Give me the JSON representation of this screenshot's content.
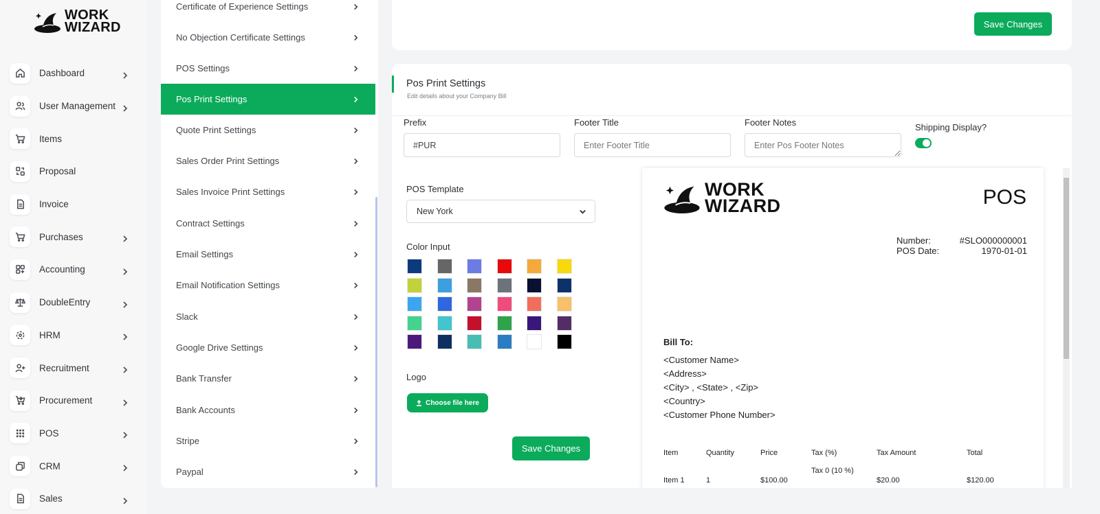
{
  "brand": {
    "line1": "WORK",
    "line2": "WIZARD"
  },
  "sidebar": {
    "items": [
      {
        "label": "Dashboard",
        "icon": "home-icon",
        "chevron": true
      },
      {
        "label": "User Management",
        "icon": "users-icon",
        "chevron": true
      },
      {
        "label": "Items",
        "icon": "cart-icon",
        "chevron": false
      },
      {
        "label": "Proposal",
        "icon": "proposal-icon",
        "chevron": false
      },
      {
        "label": "Invoice",
        "icon": "file-icon",
        "chevron": false
      },
      {
        "label": "Purchases",
        "icon": "cart-icon",
        "chevron": true
      },
      {
        "label": "Accounting",
        "icon": "grid-plus-icon",
        "chevron": true
      },
      {
        "label": "DoubleEntry",
        "icon": "scale-icon",
        "chevron": true
      },
      {
        "label": "HRM",
        "icon": "hrm-icon",
        "chevron": true
      },
      {
        "label": "Recruitment",
        "icon": "user-plus-icon",
        "chevron": true
      },
      {
        "label": "Procurement",
        "icon": "procurement-icon",
        "chevron": true
      },
      {
        "label": "POS",
        "icon": "dots-grid-icon",
        "chevron": true
      },
      {
        "label": "CRM",
        "icon": "crm-icon",
        "chevron": true
      },
      {
        "label": "Sales",
        "icon": "file-icon",
        "chevron": true
      }
    ]
  },
  "submenu": {
    "items": [
      {
        "label": "Certificate of Experience Settings",
        "active": false
      },
      {
        "label": "No Objection Certificate Settings",
        "active": false
      },
      {
        "label": "POS Settings",
        "active": false
      },
      {
        "label": "Pos Print Settings",
        "active": true
      },
      {
        "label": "Quote Print Settings",
        "active": false
      },
      {
        "label": "Sales Order Print Settings",
        "active": false
      },
      {
        "label": "Sales Invoice Print Settings",
        "active": false
      },
      {
        "label": "Contract Settings",
        "active": false
      },
      {
        "label": "Email Settings",
        "active": false
      },
      {
        "label": "Email Notification Settings",
        "active": false
      },
      {
        "label": "Slack",
        "active": false
      },
      {
        "label": "Google Drive Settings",
        "active": false
      },
      {
        "label": "Bank Transfer",
        "active": false
      },
      {
        "label": "Bank Accounts",
        "active": false
      },
      {
        "label": "Stripe",
        "active": false
      },
      {
        "label": "Paypal",
        "active": false
      }
    ]
  },
  "top_card": {
    "save_label": "Save Changes"
  },
  "form": {
    "title": "Pos Print Settings",
    "subtitle": "Edit details about your Company Bill",
    "prefix": {
      "label": "Prefix",
      "value": "#PUR",
      "placeholder": ""
    },
    "footer_title": {
      "label": "Footer Title",
      "value": "",
      "placeholder": "Enter Footer Title"
    },
    "footer_notes": {
      "label": "Footer Notes",
      "value": "",
      "placeholder": "Enter Pos Footer Notes"
    },
    "shipping": {
      "label": "Shipping Display?",
      "on": true
    },
    "template": {
      "label": "POS Template",
      "selected": "New York"
    },
    "color_label": "Color Input",
    "colors": [
      "#0d3a7d",
      "#666666",
      "#6d7be5",
      "#e80a0a",
      "#f5a93a",
      "#f7d90d",
      "#c2d23a",
      "#3d9fe0",
      "#8b7765",
      "#6d737a",
      "#081130",
      "#0f3169",
      "#3aa6ef",
      "#2f67e0",
      "#b1438f",
      "#ef4b7d",
      "#f16e5c",
      "#f8c06a",
      "#44d38f",
      "#44c4cd",
      "#c3102b",
      "#2ea34c",
      "#39177a",
      "#542d66",
      "#4c1a7c",
      "#0f2f63",
      "#47bdb4",
      "#2a7dc3",
      "#ffffff",
      "#000000"
    ],
    "logo_label": "Logo",
    "choose_file_label": "Choose file here",
    "save_label": "Save Changes"
  },
  "preview": {
    "brand": {
      "line1": "WORK",
      "line2": "WIZARD"
    },
    "doc_title": "POS",
    "number_label": "Number:",
    "number_value": "#SLO000000001",
    "date_label": "POS Date:",
    "date_value": "1970-01-01",
    "bill_to_label": "Bill To:",
    "address_lines": [
      "<Customer Name>",
      "<Address>",
      "<City> , <State> , <Zip>",
      "<Country>",
      "<Customer Phone Number>"
    ],
    "table": {
      "headers": [
        "Item",
        "Quantity",
        "Price",
        "Tax (%)",
        "Tax Amount",
        "Total"
      ],
      "rows": [
        [
          "Item 1",
          "1",
          "$100.00",
          "Tax 0 (10 %)",
          "$20.00",
          "$120.00"
        ]
      ]
    }
  }
}
